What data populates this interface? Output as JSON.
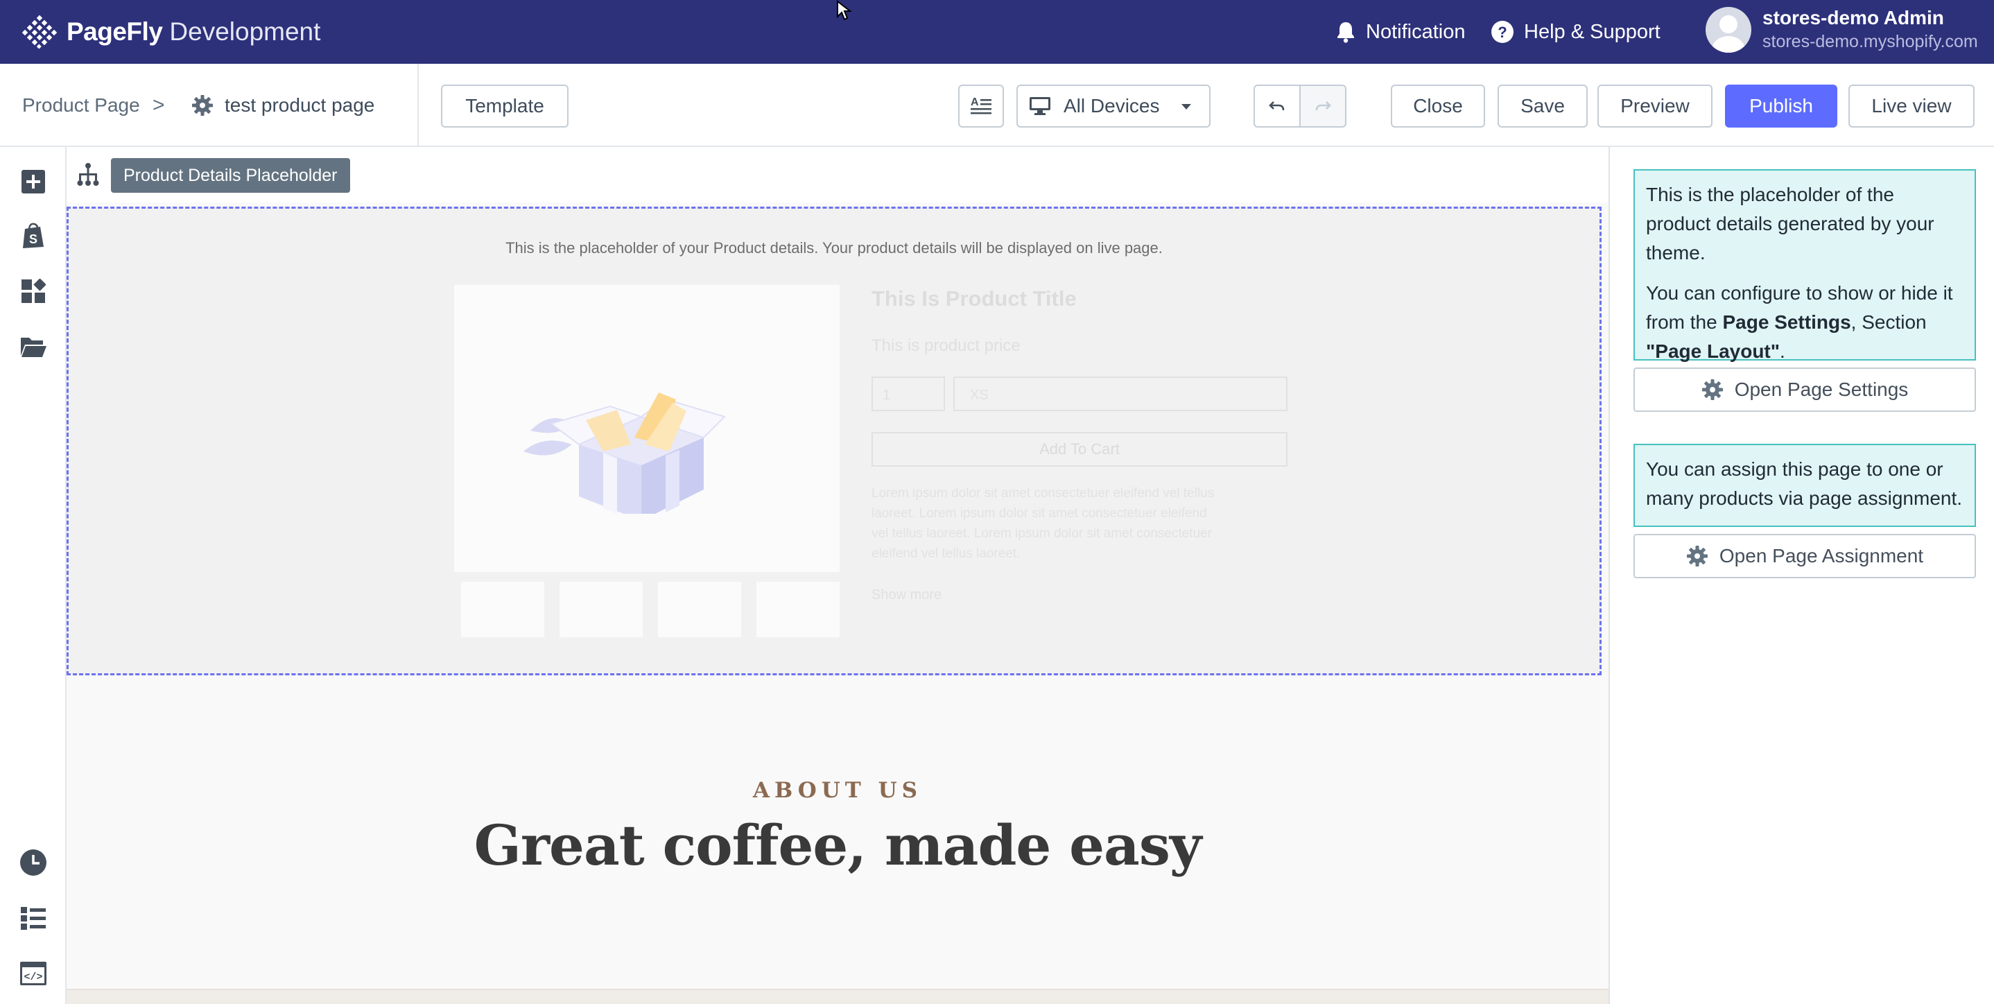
{
  "topbar": {
    "brand_name": "PageFly",
    "brand_suffix": "Development",
    "notification": "Notification",
    "help": "Help & Support",
    "user_name": "stores-demo Admin",
    "user_store": "stores-demo.myshopify.com",
    "bg_color": "#2d317a"
  },
  "toolbar": {
    "crumb_root": "Product Page",
    "crumb_sep": ">",
    "crumb_page": "test product page",
    "template": "Template",
    "devices": "All Devices",
    "close": "Close",
    "save": "Save",
    "preview": "Preview",
    "publish": "Publish",
    "live_view": "Live view",
    "publish_color": "#5d6cff"
  },
  "left_rail": {
    "icons": [
      "add-element-icon",
      "shopify-icon",
      "widgets-icon",
      "folder-icon",
      "history-icon",
      "page-outline-icon",
      "custom-code-icon"
    ]
  },
  "canvas": {
    "selected_chip": "Product Details Placeholder",
    "placeholder": {
      "note": "This is the placeholder of your Product details. Your product details will be displayed on live page.",
      "title": "This Is Product Title",
      "price": "This is product price",
      "qty": "1",
      "variant": "XS",
      "add_to_cart": "Add To Cart",
      "description": "Lorem ipsum dolor sit amet consectetuer eleifend vel tellus laoreet. Lorem ipsum dolor sit amet consectetuer eleifend vel tellus laoreet. Lorem ipsum dolor sit amet consectetuer eleifend vel tellus laoreet.",
      "show_more": "Show more"
    },
    "about_label": "ABOUT US",
    "about_heading": "Great coffee, made easy"
  },
  "right_panel": {
    "info1_line1": "This is the placeholder of the product details generated by your theme.",
    "info1_pre": "You can configure to show or hide it from the ",
    "info1_bold1": "Page Settings",
    "info1_mid": ", Section ",
    "info1_bold2": "\"Page Layout\"",
    "info1_end": ".",
    "open_settings": "Open Page Settings",
    "info2": "You can assign this page to one or many products via page assignment.",
    "open_assignment": "Open Page Assignment"
  }
}
